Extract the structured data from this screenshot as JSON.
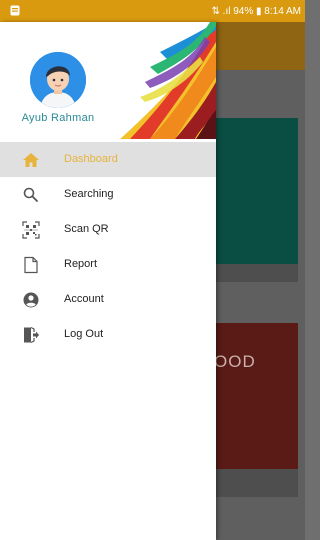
{
  "status_bar": {
    "right_text": "⇅ .ıl 94% ▮ 8:14 AM"
  },
  "background": {
    "card2_text": "OOD"
  },
  "drawer": {
    "user_name": "Ayub Rahman",
    "menu": [
      {
        "label": "Dashboard",
        "icon": "home-icon",
        "active": true
      },
      {
        "label": "Searching",
        "icon": "search-icon",
        "active": false
      },
      {
        "label": "Scan QR",
        "icon": "qr-scan-icon",
        "active": false
      },
      {
        "label": "Report",
        "icon": "document-icon",
        "active": false
      },
      {
        "label": "Account",
        "icon": "account-icon",
        "active": false
      },
      {
        "label": "Log Out",
        "icon": "logout-icon",
        "active": false
      }
    ]
  },
  "colors": {
    "status_bar": "#d99a0f",
    "active_accent": "#e6b43c",
    "card_green": "#0a4d42",
    "card_red": "#5a1a16"
  }
}
